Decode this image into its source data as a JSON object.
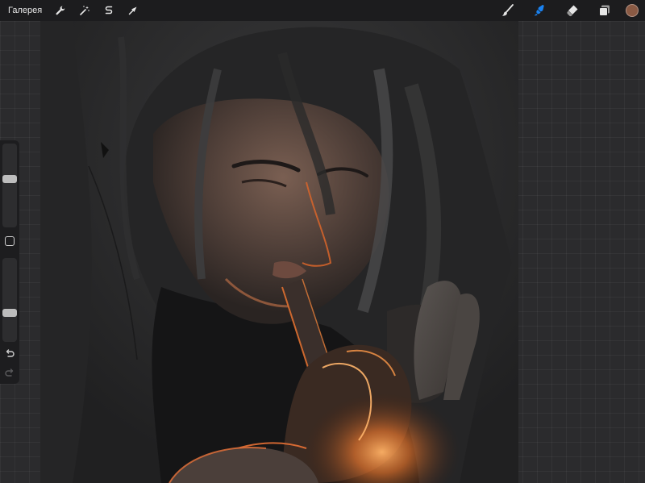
{
  "toolbar": {
    "gallery_label": "Галерея",
    "left_tools": [
      {
        "name": "actions",
        "icon": "wrench-icon"
      },
      {
        "name": "adjustments",
        "icon": "magic-wand-icon"
      },
      {
        "name": "selection",
        "icon": "selection-s-icon"
      },
      {
        "name": "transform",
        "icon": "transform-arrow-icon"
      }
    ],
    "right_tools": [
      {
        "name": "brush",
        "icon": "brush-icon",
        "active": false
      },
      {
        "name": "smudge",
        "icon": "smudge-icon",
        "active": true
      },
      {
        "name": "eraser",
        "icon": "eraser-icon",
        "active": false
      },
      {
        "name": "layers",
        "icon": "layers-icon",
        "active": false
      }
    ],
    "current_color": "#8a5a44",
    "active_tool_color": "#1a82f0"
  },
  "sidebar": {
    "brush_size_level": 0.58,
    "opacity_level": 0.33,
    "undo_icon": "undo-icon",
    "redo_icon": "redo-icon"
  },
  "canvas": {
    "artwork": "digital-painting-figure-lighting-pipe"
  }
}
